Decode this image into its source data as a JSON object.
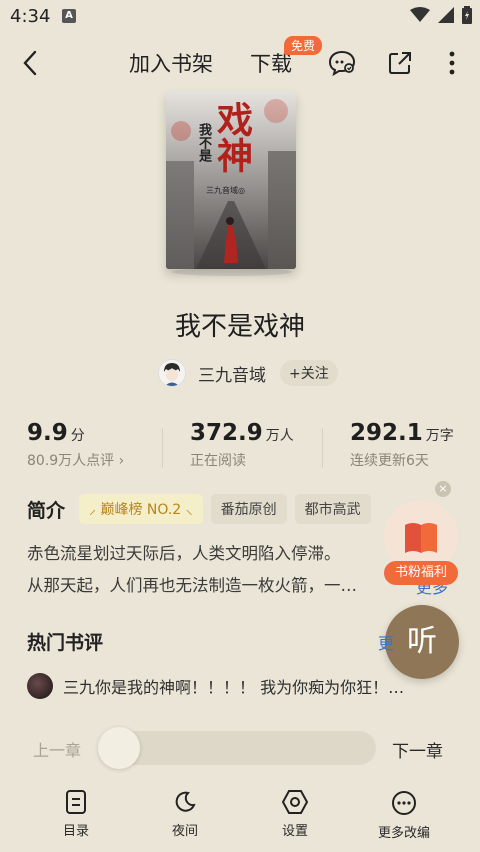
{
  "status_bar": {
    "time": "4:34",
    "notification_badge": "A"
  },
  "nav": {
    "add_shelf": "加入书架",
    "download": "下载",
    "free_badge": "免费"
  },
  "cover": {
    "title_line1": "戏神",
    "title_side": "我不是",
    "author_small": "三九音域◎"
  },
  "book": {
    "title": "我不是戏神",
    "author": "三九音域",
    "follow": "+关注"
  },
  "stats": {
    "rating": {
      "value": "9.9",
      "unit": "分",
      "sub": "80.9万人点评 ›"
    },
    "readers": {
      "value": "372.9",
      "unit": "万人",
      "sub": "正在阅读"
    },
    "words": {
      "value": "292.1",
      "unit": "万字",
      "sub": "连续更新6天"
    }
  },
  "intro": {
    "heading": "简介",
    "tags": [
      "⸝ 巅峰榜 NO.2 ⸜",
      "番茄原创",
      "都市高武"
    ],
    "line1": "赤色流星划过天际后，人类文明陷入停滞。",
    "line2": "从那天起，人们再也无法制造一枚火箭，一…",
    "more": "更多"
  },
  "welfare": {
    "label": "书粉福利",
    "close": "×"
  },
  "listen": "听",
  "hot_reviews": {
    "heading": "热门书评",
    "more": "更"
  },
  "review": {
    "text": "三九你是我的神啊！！！！ 我为你痴为你狂！…"
  },
  "chapter": {
    "prev": "上一章",
    "next": "下一章"
  },
  "bottom_bar": {
    "toc": "目录",
    "night": "夜间",
    "settings": "设置",
    "more": "更多改编"
  }
}
